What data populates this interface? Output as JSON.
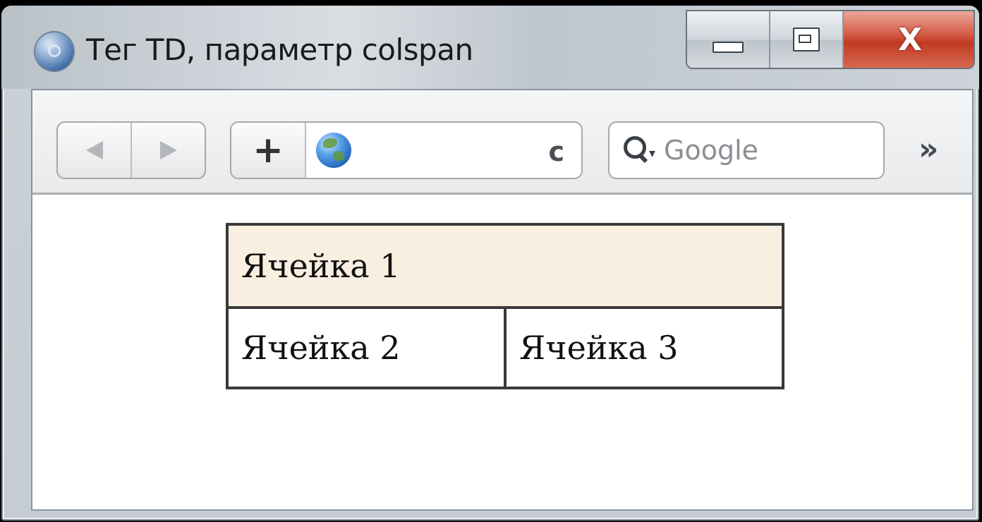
{
  "window": {
    "title": "Тег TD, параметр colspan",
    "icon": "safari-icon",
    "controls": {
      "minimize_icon": "minimize-icon",
      "maximize_icon": "maximize-icon",
      "close_label": "X"
    }
  },
  "toolbar": {
    "back_icon": "back-arrow-icon",
    "forward_icon": "forward-arrow-icon",
    "add_bookmark_label": "+",
    "site_icon": "globe-icon",
    "address_value": "",
    "reload_label": "c",
    "search_placeholder": "Google",
    "overflow_label": "»"
  },
  "page": {
    "table": {
      "rows": [
        [
          {
            "text": "Ячейка 1",
            "colspan": 2,
            "background": "#f9efe1"
          }
        ],
        [
          {
            "text": "Ячейка 2"
          },
          {
            "text": "Ячейка 3"
          }
        ]
      ]
    }
  },
  "colors": {
    "highlight_cell": "#f9efe1",
    "close_button": "#c03a22",
    "table_border": "#3a3a3a"
  }
}
